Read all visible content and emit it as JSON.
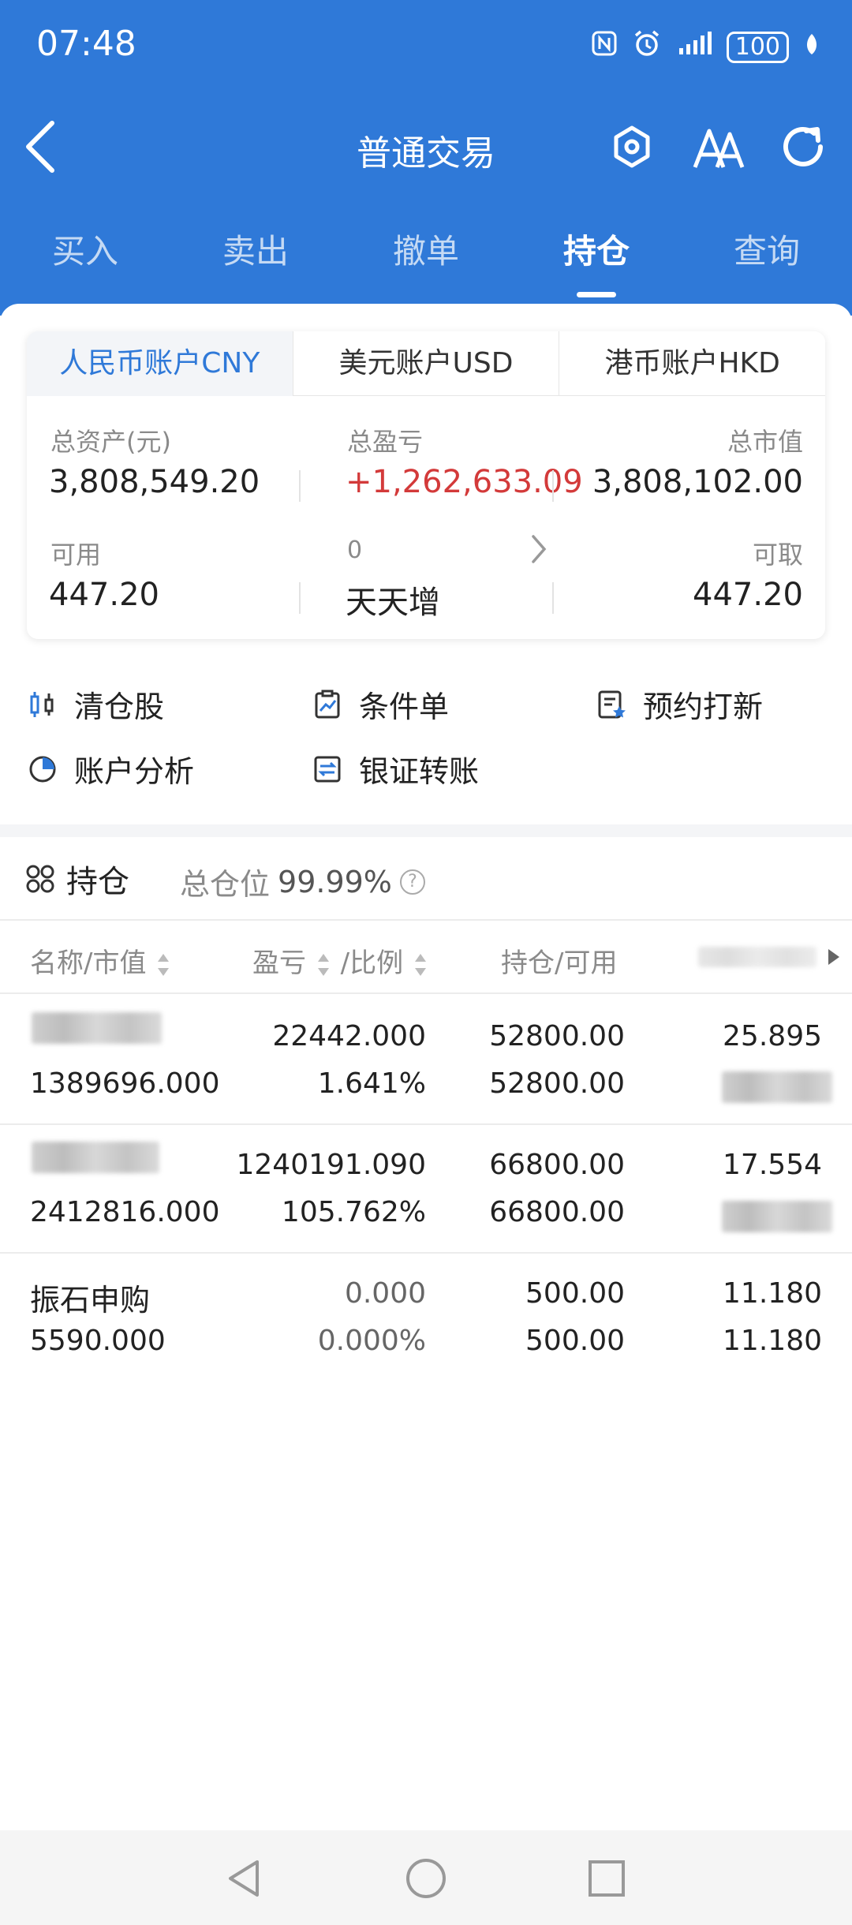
{
  "status_bar": {
    "time": "07:48",
    "battery": "100"
  },
  "header": {
    "title": "普通交易"
  },
  "tabs": [
    {
      "label": "买入"
    },
    {
      "label": "卖出"
    },
    {
      "label": "撤单"
    },
    {
      "label": "持仓"
    },
    {
      "label": "查询"
    }
  ],
  "account": {
    "currency_tabs": [
      {
        "label": "人民币账户CNY"
      },
      {
        "label": "美元账户USD"
      },
      {
        "label": "港币账户HKD"
      }
    ],
    "total_assets_label": "总资产(元)",
    "total_assets": "3,808,549.20",
    "total_pnl_label": "总盈亏",
    "total_pnl": "+1,262,633.09",
    "market_value_label": "总市值",
    "market_value": "3,808,102.00",
    "available_label": "可用",
    "available": "447.20",
    "tiantianzeng_count": "0",
    "tiantianzeng_label": "天天增",
    "withdrawable_label": "可取",
    "withdrawable": "447.20"
  },
  "quick_actions": [
    {
      "label": "清仓股"
    },
    {
      "label": "条件单"
    },
    {
      "label": "预约打新"
    },
    {
      "label": "账户分析"
    },
    {
      "label": "银证转账"
    }
  ],
  "holdings": {
    "title": "持仓",
    "position_ratio_label": "总仓位",
    "position_ratio": "99.99%",
    "columns": {
      "name_mv": "名称/市值",
      "pnl": "盈亏",
      "ratio": "/比例",
      "hold_avail": "持仓/可用"
    },
    "rows": [
      {
        "name": "",
        "market_value": "1389696.000",
        "pnl": "22442.000",
        "pnl_ratio": "1.641%",
        "position": "52800.00",
        "available": "52800.00",
        "price": "25.895",
        "cost": ""
      },
      {
        "name": "",
        "market_value": "2412816.000",
        "pnl": "1240191.090",
        "pnl_ratio": "105.762%",
        "position": "66800.00",
        "available": "66800.00",
        "price": "17.554",
        "cost": ""
      },
      {
        "name": "振石申购",
        "market_value": "5590.000",
        "pnl": "0.000",
        "pnl_ratio": "0.000%",
        "position": "500.00",
        "available": "500.00",
        "price": "11.180",
        "cost": "11.180"
      }
    ]
  },
  "colors": {
    "primary": "#2f79d8",
    "loss_gain_red": "#d33a3a"
  }
}
